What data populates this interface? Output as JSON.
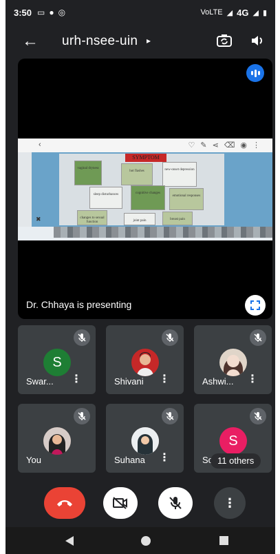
{
  "status_bar": {
    "time": "3:50",
    "notif_icons": [
      "cast-icon",
      "chat-bubble-icon",
      "instagram-icon"
    ],
    "network_vo": "VoLTE",
    "network": "4G",
    "signal_icon": "signal-icon",
    "battery_icon": "battery-icon"
  },
  "header": {
    "meeting_code": "urh-nsee-uin",
    "caret": "▸"
  },
  "presentation": {
    "presenter_text": "Dr. Chhaya is presenting",
    "slide_heading": "SYMPTOM",
    "slide_cards": [
      "vaginal dryness",
      "hot flashes",
      "new-onset depression",
      "sleep disturbances",
      "cognitive changes",
      "emotional responses",
      "changes to sexual function",
      "joint pain",
      "breast pain"
    ]
  },
  "participants": [
    {
      "name": "Swar...",
      "initial": "S",
      "avatar_color": "#1e7e34",
      "muted": true
    },
    {
      "name": "Shivani",
      "initial": "",
      "avatar_color": "#c62828",
      "muted": true
    },
    {
      "name": "Ashwi...",
      "initial": "",
      "avatar_color": "#e0d5c9",
      "muted": true
    },
    {
      "name": "You",
      "initial": "",
      "avatar_color": "#5d4037",
      "muted": true
    },
    {
      "name": "Suhana",
      "initial": "",
      "avatar_color": "#d7ccc8",
      "muted": true
    },
    {
      "name": "So",
      "initial": "S",
      "avatar_color": "#e91e63",
      "muted": true,
      "others_label": "11 others"
    }
  ],
  "controls": {
    "end_call_icon": "end-call-icon",
    "camera_off_icon": "camera-off-icon",
    "mic_off_icon": "mic-off-icon",
    "more_icon": "more-vert-icon"
  },
  "colors": {
    "background": "#202124",
    "tile": "#3c4043",
    "end_call": "#ea4335",
    "accent": "#1a73e8"
  }
}
